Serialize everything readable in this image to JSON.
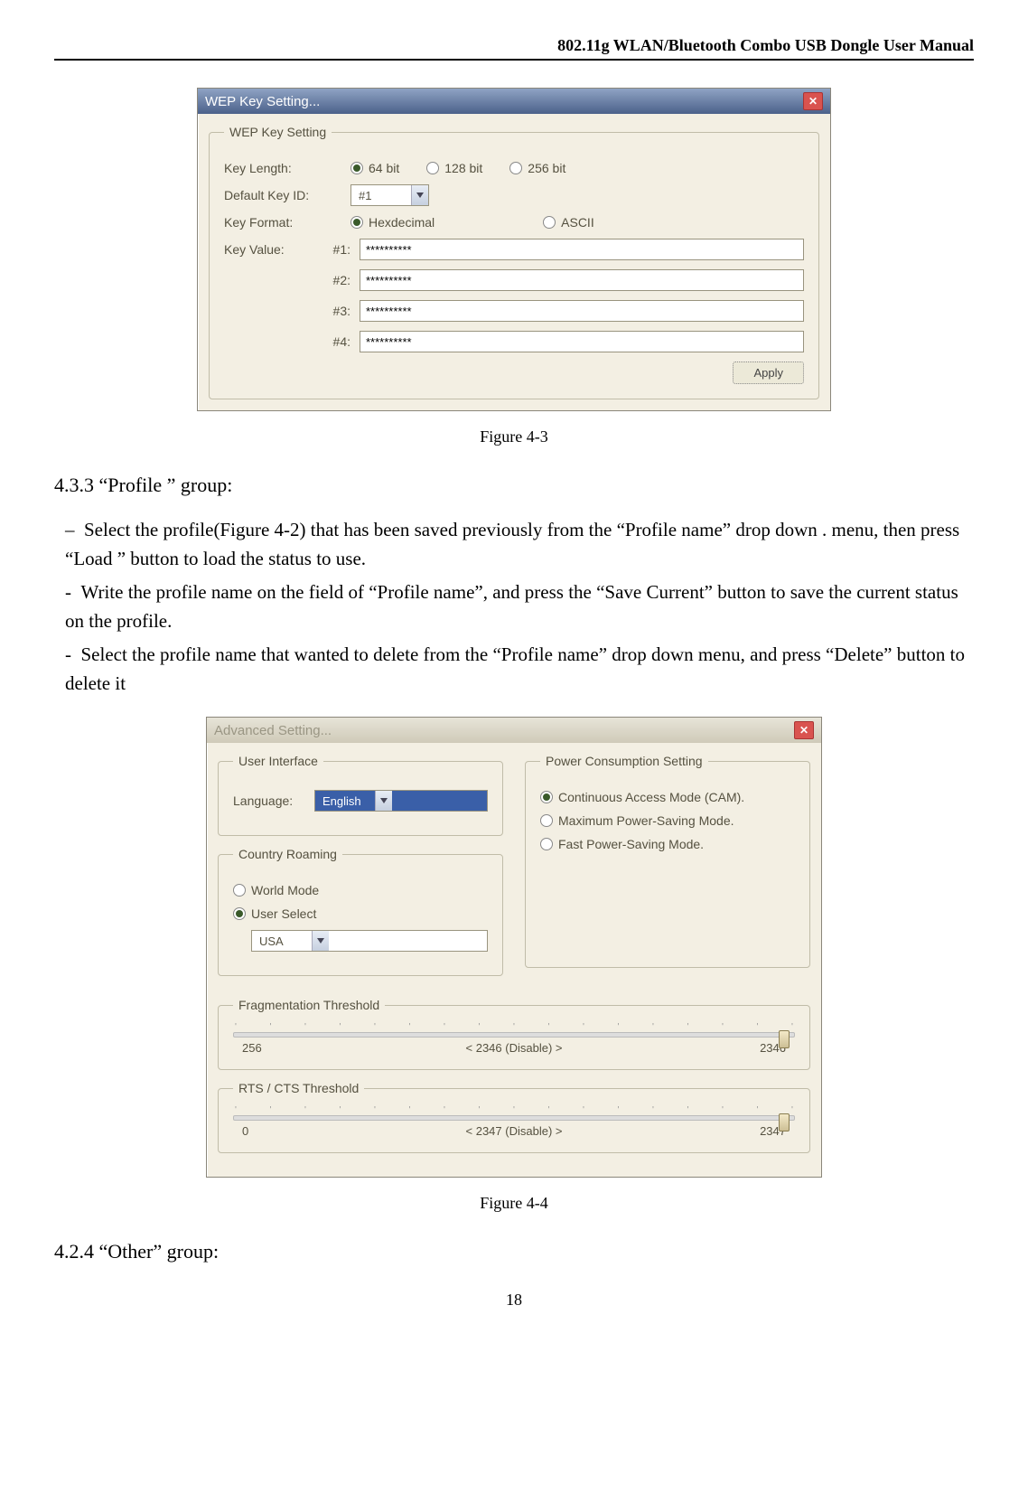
{
  "header": "802.11g WLAN/Bluetooth Combo USB Dongle User Manual",
  "dialog1": {
    "title": "WEP Key Setting...",
    "groupTitle": "WEP Key Setting",
    "keyLengthLabel": "Key Length:",
    "keyLengthOptions": {
      "o64": "64 bit",
      "o128": "128 bit",
      "o256": "256 bit"
    },
    "defaultKeyIdLabel": "Default Key ID:",
    "defaultKeyIdValue": "#1",
    "keyFormatLabel": "Key Format:",
    "keyFormatOptions": {
      "hex": "Hexdecimal",
      "ascii": "ASCII"
    },
    "keyValueLabel": "Key Value:",
    "keys": {
      "k1": {
        "label": "#1:",
        "value": "**********"
      },
      "k2": {
        "label": "#2:",
        "value": "**********"
      },
      "k3": {
        "label": "#3:",
        "value": "**********"
      },
      "k4": {
        "label": "#4:",
        "value": "**********"
      }
    },
    "applyLabel": "Apply"
  },
  "fig43": "Figure 4-3",
  "section433": "4.3.3 “Profile ” group:",
  "bullets": {
    "b1": "Select the profile(Figure 4-2) that has been saved previously from the “Profile name” drop down . menu, then press “Load ” button to load the status to use.",
    "b2": "Write the profile name on the field of “Profile name”, and press the “Save Current” button to save the current status on the profile.",
    "b3": "Select the profile name that wanted to delete from the “Profile name” drop down menu, and press “Delete” button to delete it"
  },
  "dialog2": {
    "title": "Advanced Setting...",
    "ui": {
      "group": "User Interface",
      "langLabel": "Language:",
      "langValue": "English"
    },
    "country": {
      "group": "Country Roaming",
      "world": "World Mode",
      "user": "User Select",
      "value": "USA"
    },
    "power": {
      "group": "Power Consumption Setting",
      "cam": "Continuous Access Mode (CAM).",
      "max": "Maximum Power-Saving Mode.",
      "fast": "Fast Power-Saving Mode."
    },
    "frag": {
      "group": "Fragmentation Threshold",
      "min": "256",
      "mid": "< 2346 (Disable) >",
      "max": "2346"
    },
    "rts": {
      "group": "RTS / CTS Threshold",
      "min": "0",
      "mid": "< 2347 (Disable) >",
      "max": "2347"
    }
  },
  "fig44": "Figure 4-4",
  "section424": "4.2.4  “Other” group:",
  "pagenum": "18"
}
